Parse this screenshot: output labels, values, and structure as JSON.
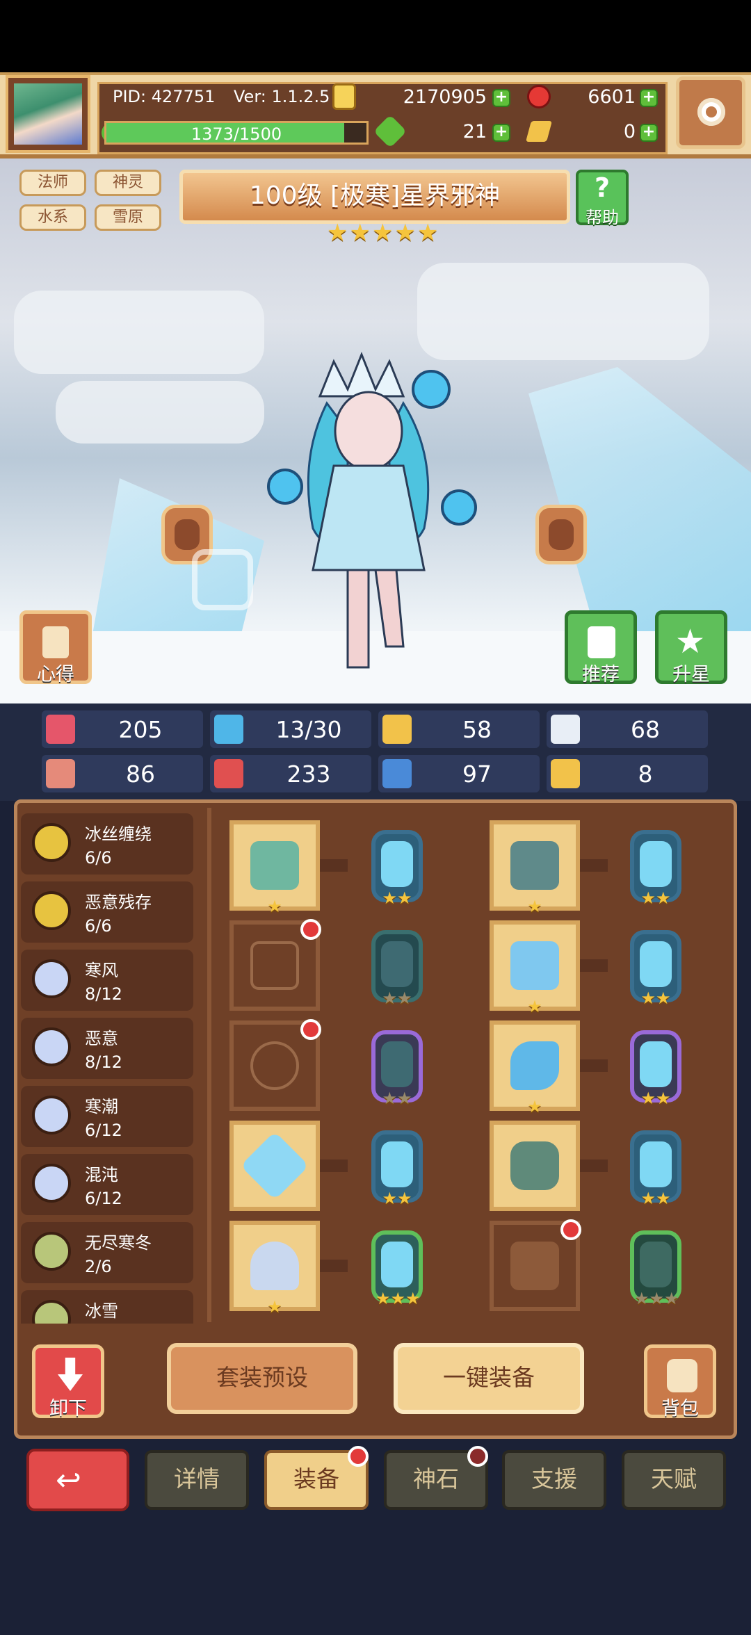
{
  "header": {
    "pid": "PID: 427751",
    "version": "Ver: 1.1.2.5",
    "gold": "2170905",
    "gems": "6601",
    "xp_text": "1373/1500",
    "xp_fraction": 0.915,
    "clover": "21",
    "key": "0",
    "colors": {
      "gold": "#f6d35a",
      "gem": "#e53935",
      "clover": "#5fbf3a",
      "key": "#f2c24a"
    }
  },
  "tags": [
    "法师",
    "神灵",
    "水系",
    "雪原"
  ],
  "hero": {
    "title": "100级 [极寒]星界邪神",
    "stars": 5,
    "help_label": "帮助",
    "xinde_label": "心得",
    "recommend_label": "推荐",
    "upstar_label": "升星"
  },
  "stats": [
    {
      "icon": "heart-icon",
      "value": "205",
      "color": "#e5566a"
    },
    {
      "icon": "drop-icon",
      "value": "13/30",
      "color": "#4fb6e8"
    },
    {
      "icon": "shield-icon",
      "value": "58",
      "color": "#f2c24a"
    },
    {
      "icon": "wing-icon",
      "value": "68",
      "color": "#e8eef6"
    },
    {
      "icon": "fist-icon",
      "value": "86",
      "color": "#e58a7a"
    },
    {
      "icon": "book-icon",
      "value": "233",
      "color": "#e05050"
    },
    {
      "icon": "boot-icon",
      "value": "97",
      "color": "#4a8ad8"
    },
    {
      "icon": "magnet-icon",
      "value": "8",
      "color": "#f2c24a"
    }
  ],
  "sets": [
    {
      "name": "冰丝缠绕",
      "count": "6/6",
      "color": "#e7c340"
    },
    {
      "name": "恶意残存",
      "count": "6/6",
      "color": "#e7c340"
    },
    {
      "name": "寒风",
      "count": "8/12",
      "color": "#c9d6f5"
    },
    {
      "name": "恶意",
      "count": "8/12",
      "color": "#c9d6f5"
    },
    {
      "name": "寒潮",
      "count": "6/12",
      "color": "#c9d6f5"
    },
    {
      "name": "混沌",
      "count": "6/12",
      "color": "#c9d6f5"
    },
    {
      "name": "无尽寒冬",
      "count": "2/6",
      "color": "#b8c67a"
    },
    {
      "name": "冰雪",
      "count": "",
      "color": "#b8c67a"
    }
  ],
  "actions": {
    "unequip": "卸下",
    "preset": "套装预设",
    "auto_equip": "一键装备",
    "bag": "背包"
  },
  "tabs": [
    "详情",
    "装备",
    "神石",
    "支援",
    "天赋"
  ]
}
